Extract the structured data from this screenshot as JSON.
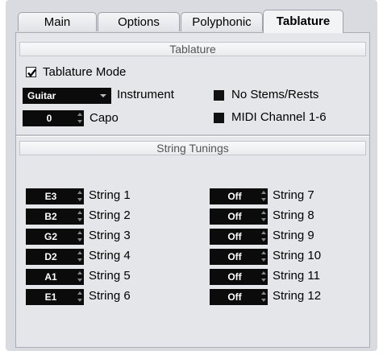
{
  "tabs": [
    "Main",
    "Options",
    "Polyphonic",
    "Tablature"
  ],
  "tablature": {
    "section_title": "Tablature",
    "mode_label": "Tablature Mode",
    "instrument_value": "Guitar",
    "instrument_label": "Instrument",
    "capo_value": "0",
    "capo_label": "Capo",
    "no_stems_label": "No Stems/Rests",
    "midi_channel_label": "MIDI Channel 1-6"
  },
  "tunings": {
    "section_title": "String Tunings",
    "left": [
      {
        "value": "E3",
        "label": "String 1"
      },
      {
        "value": "B2",
        "label": "String 2"
      },
      {
        "value": "G2",
        "label": "String 3"
      },
      {
        "value": "D2",
        "label": "String 4"
      },
      {
        "value": "A1",
        "label": "String 5"
      },
      {
        "value": "E1",
        "label": "String 6"
      }
    ],
    "right": [
      {
        "value": "Off",
        "label": "String 7"
      },
      {
        "value": "Off",
        "label": "String 8"
      },
      {
        "value": "Off",
        "label": "String 9"
      },
      {
        "value": "Off",
        "label": "String 10"
      },
      {
        "value": "Off",
        "label": "String 11"
      },
      {
        "value": "Off",
        "label": "String 12"
      }
    ]
  }
}
